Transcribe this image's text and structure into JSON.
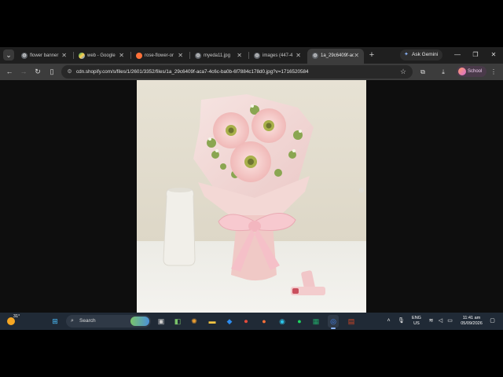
{
  "tabs": [
    {
      "title": "flower banner",
      "favicon": "globe-icon",
      "active": false
    },
    {
      "title": "web - Google",
      "favicon": "google-drive-icon",
      "active": false
    },
    {
      "title": "rose-flower-or",
      "favicon": "firefox-like-icon",
      "active": false
    },
    {
      "title": "myeda11.jpg",
      "favicon": "globe-icon",
      "active": false
    },
    {
      "title": "images (447-4",
      "favicon": "globe-icon",
      "active": false
    },
    {
      "title": "1a_29c6409f-ac",
      "favicon": "globe-icon",
      "active": true
    }
  ],
  "gemini": {
    "label": "Ask Gemini"
  },
  "address": {
    "url": "cdn.shopify.com/s/files/1/2601/3352/files/1a_29c6409f-aca7-4c6c-ba0b-6f7884c178d0.jpg?v=1716520584"
  },
  "profile": {
    "label": "School"
  },
  "weather": {
    "temp": "31°"
  },
  "taskbar": {
    "search_label": "Search"
  },
  "tray": {
    "lang_top": "ENG",
    "lang_bottom": "US",
    "time": "11:41 am",
    "date": "05/09/2026"
  },
  "colors": {
    "tab_strip": "#1f1f1f",
    "toolbar": "#3c3c3c",
    "taskbar": "#202a36",
    "accent": "#8ab4f8"
  }
}
